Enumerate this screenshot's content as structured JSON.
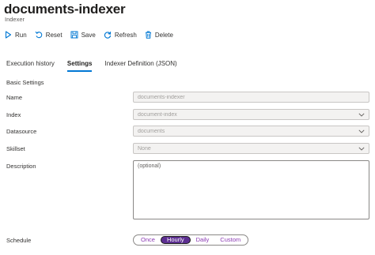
{
  "header": {
    "title": "documents-indexer",
    "more": "···",
    "subtitle": "Indexer"
  },
  "toolbar": {
    "run": "Run",
    "reset": "Reset",
    "save": "Save",
    "refresh": "Refresh",
    "delete": "Delete"
  },
  "tabs": [
    {
      "label": "Execution history",
      "active": false
    },
    {
      "label": "Settings",
      "active": true
    },
    {
      "label": "Indexer Definition (JSON)",
      "active": false
    }
  ],
  "form": {
    "section_title": "Basic Settings",
    "name": {
      "label": "Name",
      "value": "documents-indexer"
    },
    "index": {
      "label": "Index",
      "value": "document-index"
    },
    "datasource": {
      "label": "Datasource",
      "value": "documents"
    },
    "skillset": {
      "label": "Skillset",
      "value": "None"
    },
    "description": {
      "label": "Description",
      "placeholder": "(optional)"
    },
    "schedule": {
      "label": "Schedule",
      "options": [
        "Once",
        "Hourly",
        "Daily",
        "Custom"
      ],
      "selected": "Hourly"
    }
  },
  "colors": {
    "accent": "#0078d4",
    "segment_selected": "#5c2e91",
    "segment_text": "#8b3ab3"
  }
}
